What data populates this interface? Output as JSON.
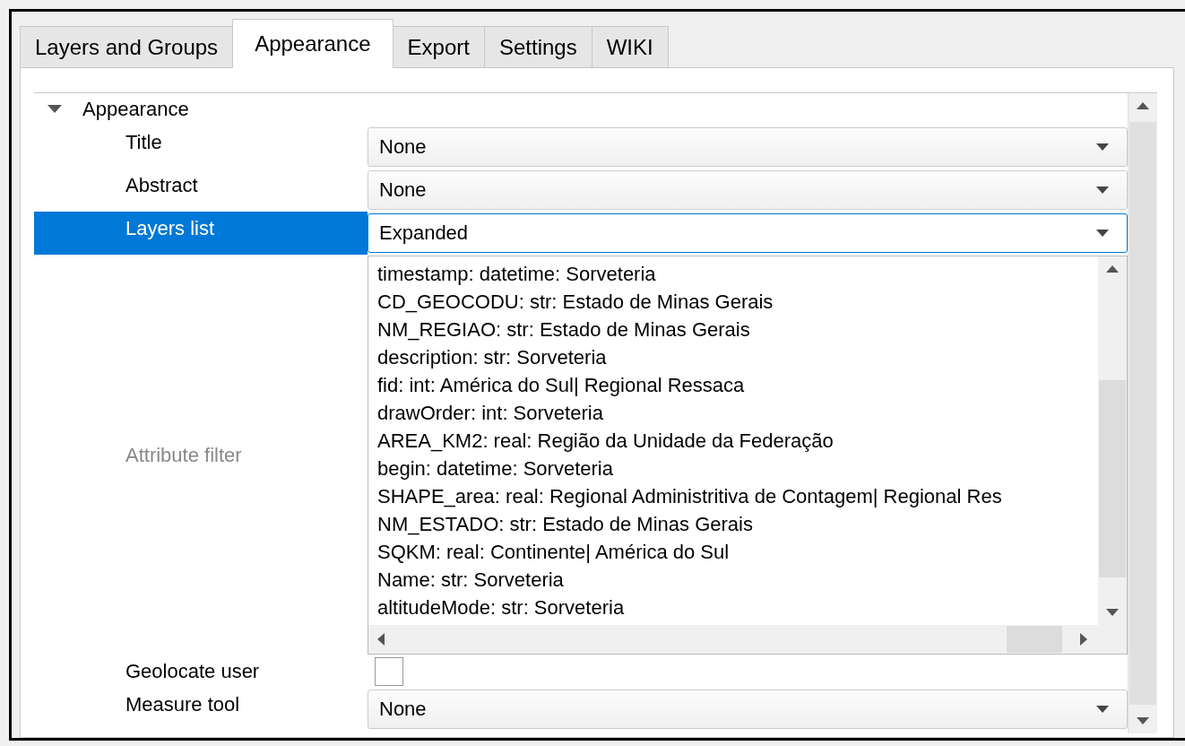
{
  "tabs": [
    {
      "label": "Layers and Groups",
      "selected": false
    },
    {
      "label": "Appearance",
      "selected": true
    },
    {
      "label": "Export",
      "selected": false
    },
    {
      "label": "Settings",
      "selected": false
    },
    {
      "label": "WIKI",
      "selected": false
    }
  ],
  "section": {
    "title": "Appearance",
    "expanded": true
  },
  "rows": [
    {
      "kind": "combo",
      "label": "Title",
      "value": "None",
      "selected": false,
      "disabled": false
    },
    {
      "kind": "combo",
      "label": "Abstract",
      "value": "None",
      "selected": false,
      "disabled": false
    },
    {
      "kind": "combo",
      "label": "Layers list",
      "value": "Expanded",
      "selected": true,
      "disabled": false
    },
    {
      "kind": "list",
      "label": "Attribute filter",
      "selected": false,
      "disabled": true,
      "items": [
        "timestamp: datetime: Sorveteria",
        "CD_GEOCODU: str: Estado de Minas Gerais",
        "NM_REGIAO: str: Estado de Minas Gerais",
        "description: str: Sorveteria",
        "fid: int: América do Sul| Regional Ressaca",
        "drawOrder: int: Sorveteria",
        "AREA_KM2: real: Região da Unidade da Federação",
        "begin: datetime: Sorveteria",
        "SHAPE_area: real: Regional Administritiva de Contagem| Regional Res",
        "NM_ESTADO: str: Estado de Minas Gerais",
        "SQKM: real: Continente| América do Sul",
        "Name: str: Sorveteria",
        "altitudeMode: str: Sorveteria"
      ]
    },
    {
      "kind": "checkbox",
      "label": "Geolocate user",
      "checked": false,
      "selected": false,
      "disabled": false
    },
    {
      "kind": "combo",
      "label": "Measure tool",
      "value": "None",
      "selected": false,
      "disabled": false
    }
  ]
}
